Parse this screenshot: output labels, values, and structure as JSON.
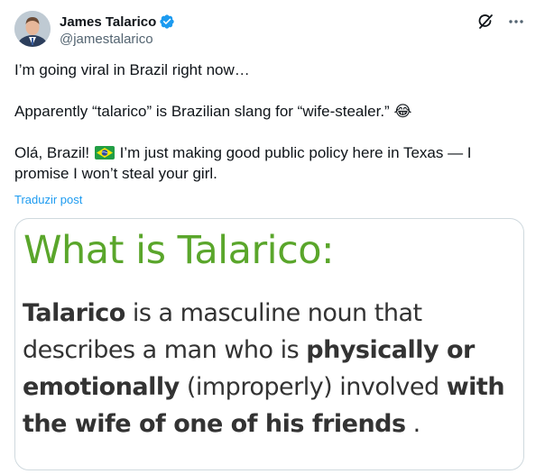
{
  "tweet": {
    "author": {
      "display_name": "James Talarico",
      "handle": "@jamestalarico",
      "avatar_icon": "profile-photo"
    },
    "icons": {
      "verified": "verified-badge-icon",
      "grok": "grok-icon",
      "more": "more-icon"
    },
    "text": {
      "line1": "I’m going viral in Brazil right now…",
      "line2": "Apparently “talarico” is Brazilian slang for “wife-stealer.”",
      "line2_emoji": "😂",
      "line3_start": "Olá, Brazil!",
      "line3_rest": " I’m just making good public policy here in Texas — I promise I won’t steal your girl."
    },
    "translate_label": "Traduzir post",
    "image": {
      "heading": "What is Talarico:",
      "seg1": "Talarico",
      "seg2": " is a masculine noun that describes a man who is ",
      "seg3": "physically or emotionally",
      "seg4": " (improperly) involved ",
      "seg5": "with the wife of one of his friends",
      "seg6": " ."
    },
    "colors": {
      "accent": "#1d9bf0",
      "heading_green": "#5aa62b",
      "handle_gray": "#536471"
    }
  }
}
